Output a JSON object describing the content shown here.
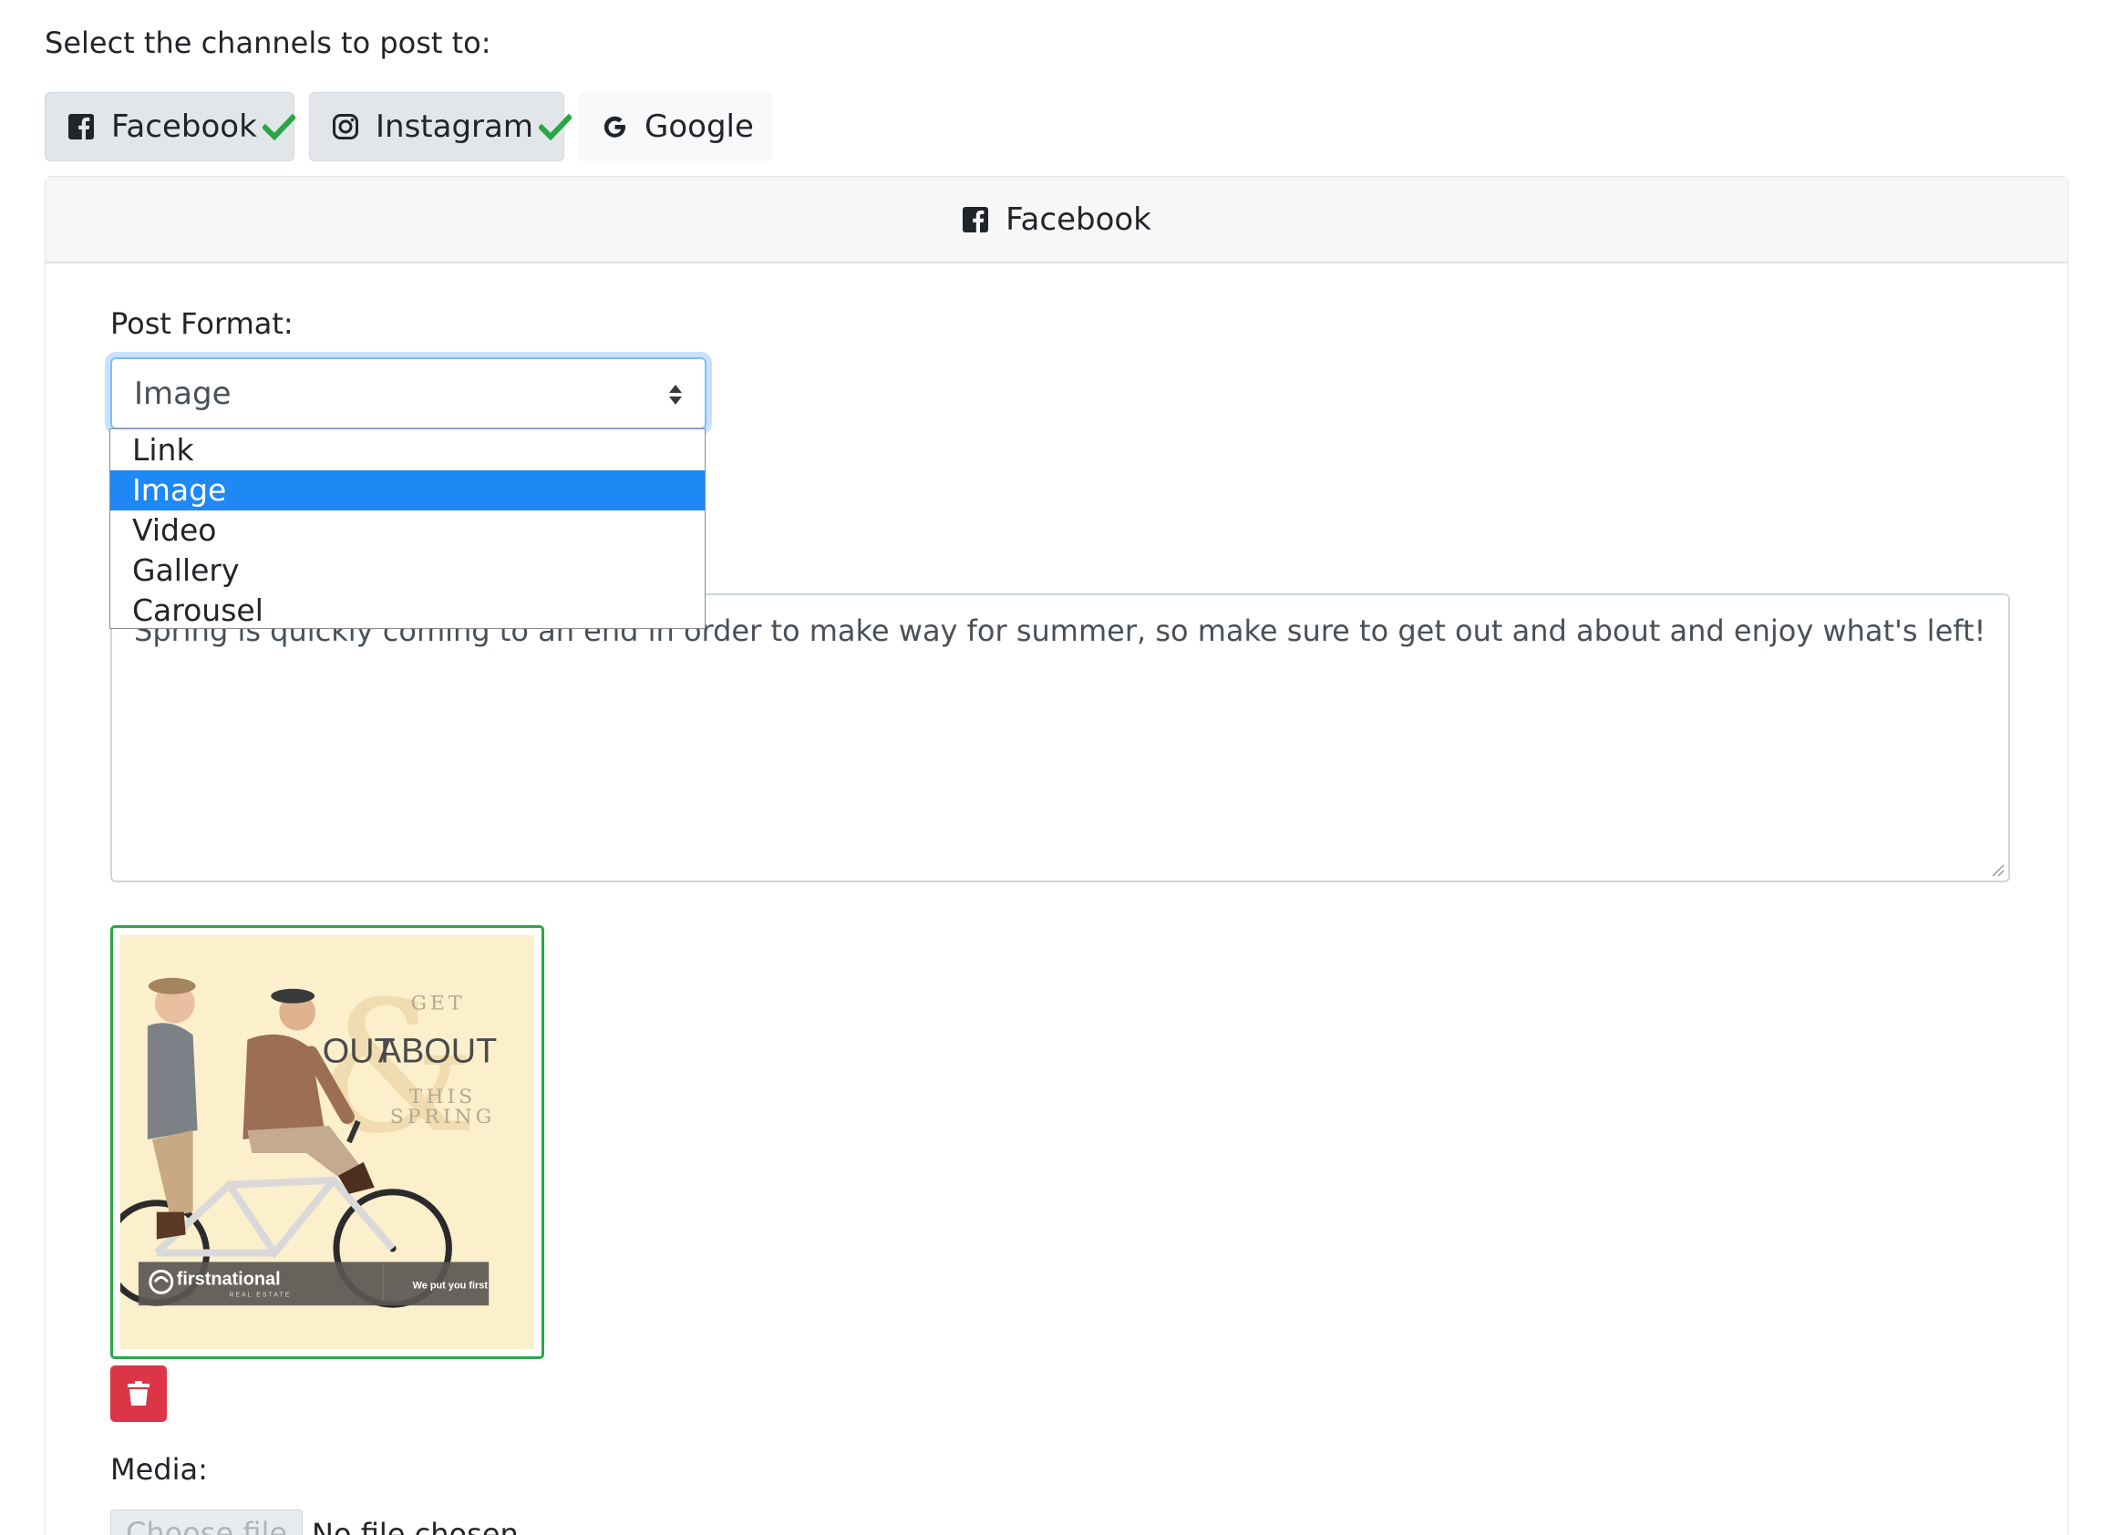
{
  "prompt": "Select the channels to post to:",
  "channels": [
    {
      "label": "Facebook",
      "icon": "facebook-icon",
      "selected": true
    },
    {
      "label": "Instagram",
      "icon": "instagram-icon",
      "selected": true
    },
    {
      "label": "Google",
      "icon": "google-icon",
      "selected": false
    }
  ],
  "panel": {
    "title": "Facebook",
    "icon": "facebook-icon"
  },
  "post_format": {
    "label": "Post Format:",
    "value": "Image",
    "options": [
      "Link",
      "Image",
      "Video",
      "Gallery",
      "Carousel"
    ],
    "selected_index": 1
  },
  "message": {
    "value": "Spring is quickly coming to an end in order to make way for summer, so make sure to get out and about and enjoy what's left!"
  },
  "media_preview": {
    "headline_top": "GET",
    "headline_left": "OUT",
    "headline_right": "ABOUT",
    "sub_line1": "THIS",
    "sub_line2": "SPRING",
    "brand": "firstnational",
    "brand_sub": "REAL ESTATE",
    "tagline": "We put you first"
  },
  "delete_icon": "trash-icon",
  "media": {
    "label": "Media:",
    "button": "Choose file",
    "status": "No file chosen"
  },
  "colors": {
    "check": "#28a745",
    "selection": "#1e88f5",
    "danger": "#dc3545",
    "focus": "#80bdff"
  }
}
